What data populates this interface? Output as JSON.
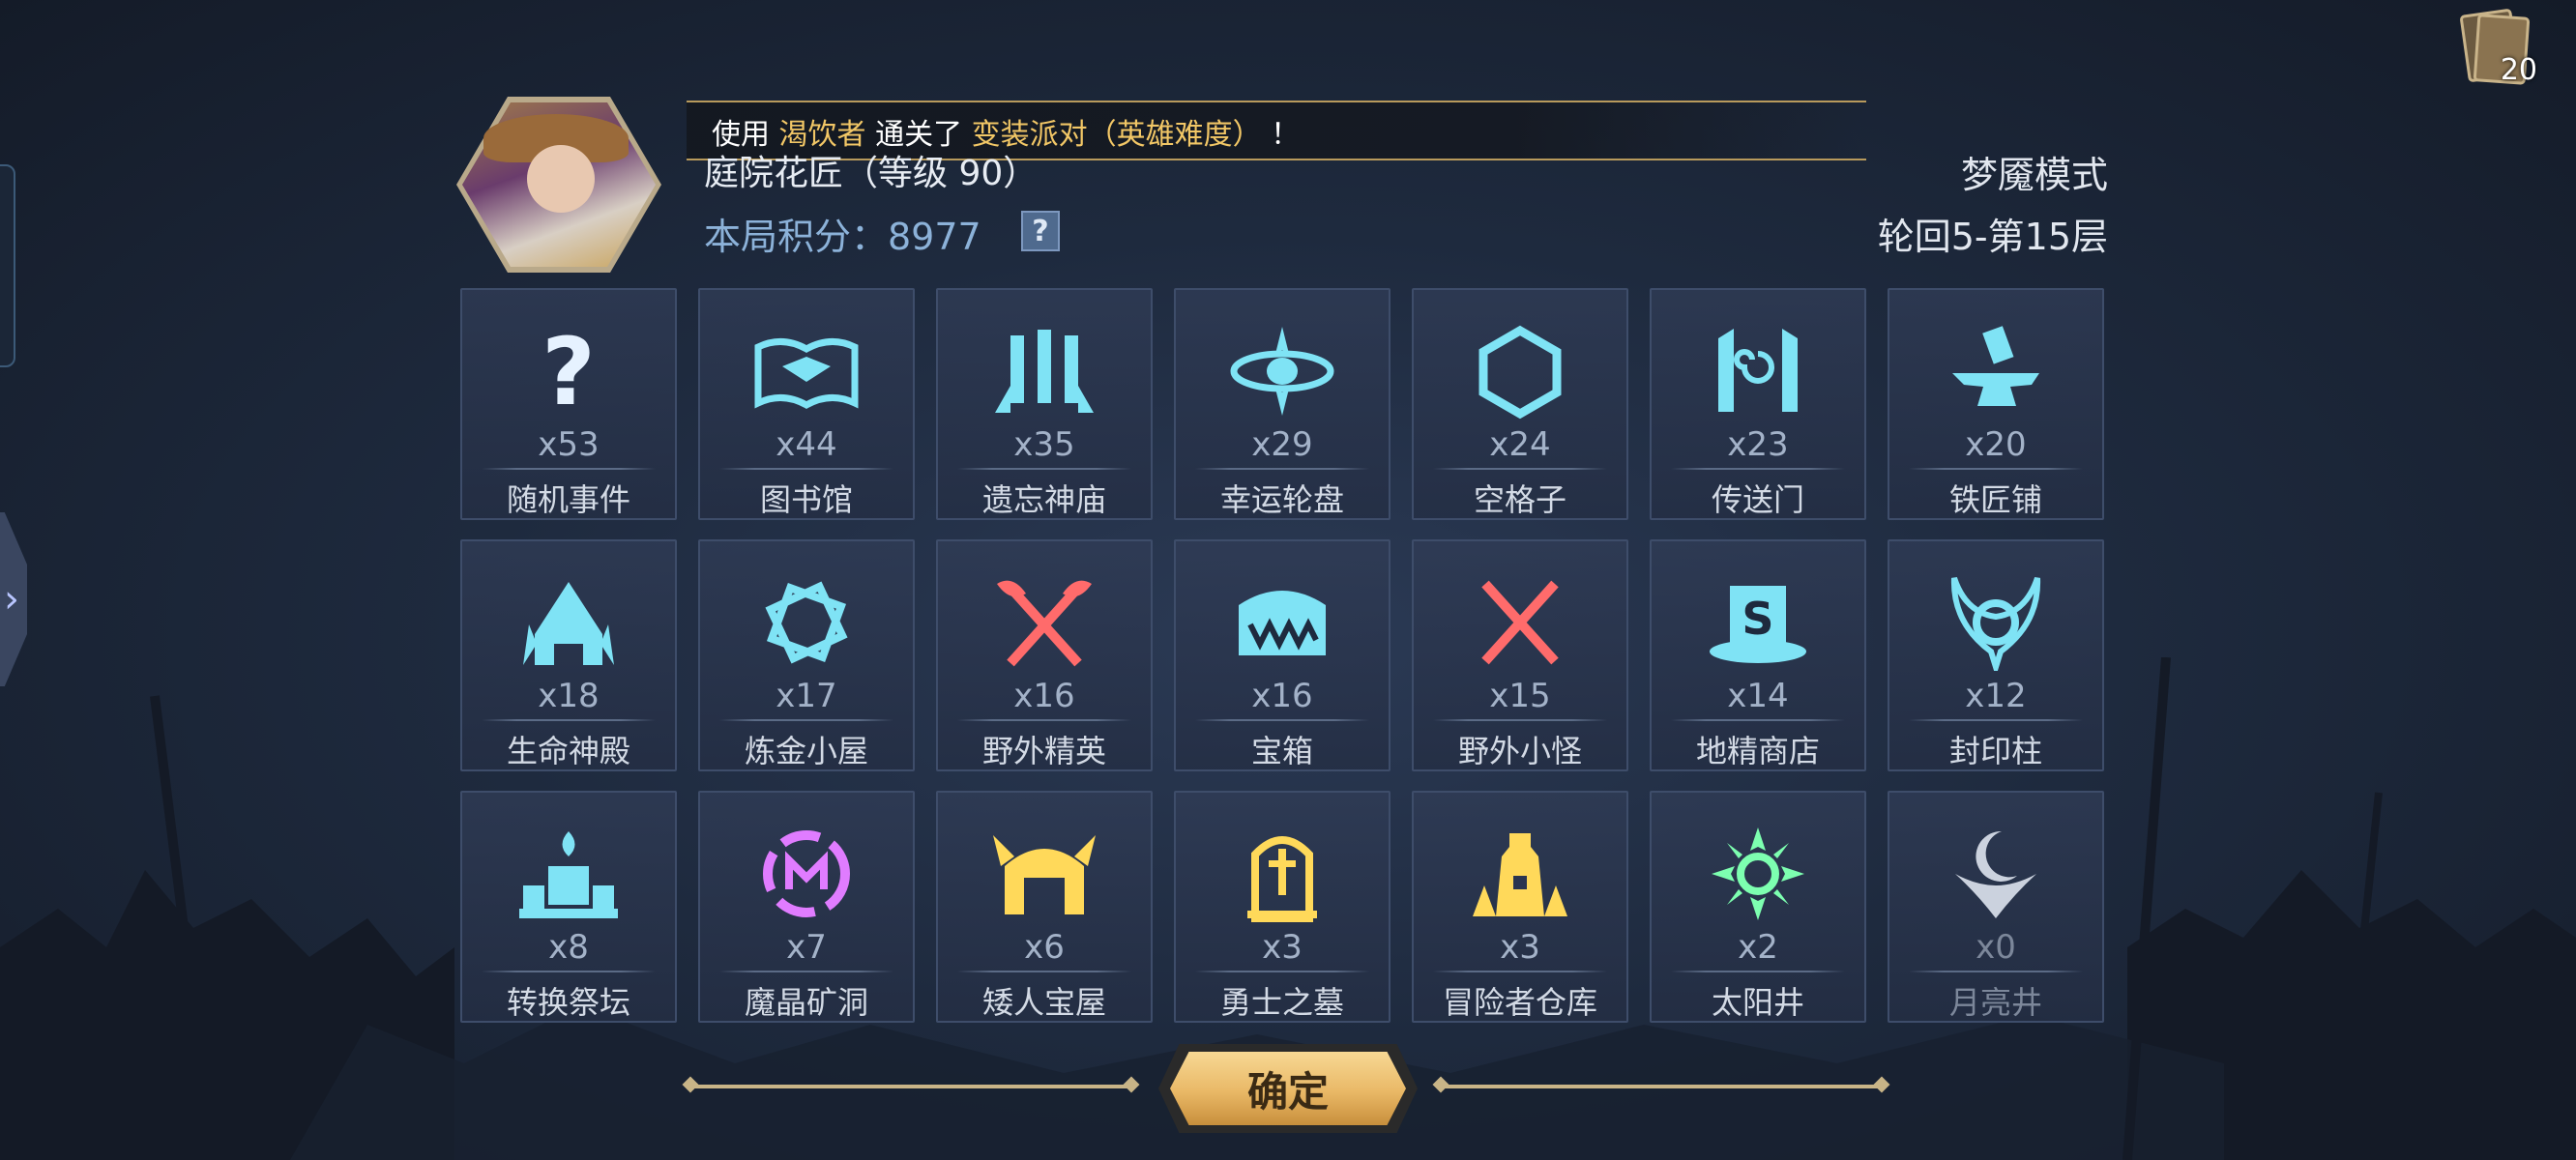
{
  "header": {
    "notice_prefix": "使用 ",
    "notice_hero": "渴饮者",
    "notice_mid": " 通关了 ",
    "notice_event": "变装派对（英雄难度）",
    "notice_suffix": " ！",
    "player_name": "庭院花匠（等级 90）",
    "score_label": "本局积分：8977",
    "help_label": "?",
    "mode": "梦魇模式",
    "floor": "轮回5-第15层"
  },
  "deck": {
    "count": "20"
  },
  "nodes": [
    {
      "count": "x53",
      "label": "随机事件",
      "icon": "question-icon",
      "color": "#d8ecff"
    },
    {
      "count": "x44",
      "label": "图书馆",
      "icon": "book-icon",
      "color": "#7fe3f5"
    },
    {
      "count": "x35",
      "label": "遗忘神庙",
      "icon": "temple-icon",
      "color": "#7fe3f5"
    },
    {
      "count": "x29",
      "label": "幸运轮盘",
      "icon": "wheel-icon",
      "color": "#7fe3f5"
    },
    {
      "count": "x24",
      "label": "空格子",
      "icon": "hexagon-icon",
      "color": "#7fe3f5"
    },
    {
      "count": "x23",
      "label": "传送门",
      "icon": "portal-icon",
      "color": "#7fe3f5"
    },
    {
      "count": "x20",
      "label": "铁匠铺",
      "icon": "anvil-icon",
      "color": "#7fe3f5"
    },
    {
      "count": "x18",
      "label": "生命神殿",
      "icon": "life-shrine-icon",
      "color": "#7fe3f5"
    },
    {
      "count": "x17",
      "label": "炼金小屋",
      "icon": "alchemy-icon",
      "color": "#7fe3f5"
    },
    {
      "count": "x16",
      "label": "野外精英",
      "icon": "crossed-axes-icon",
      "color": "#ff6b6b"
    },
    {
      "count": "x16",
      "label": "宝箱",
      "icon": "chest-icon",
      "color": "#7fe3f5"
    },
    {
      "count": "x15",
      "label": "野外小怪",
      "icon": "crossed-swords-icon",
      "color": "#ff6b6b"
    },
    {
      "count": "x14",
      "label": "地精商店",
      "icon": "shop-hat-icon",
      "color": "#7fe3f5"
    },
    {
      "count": "x12",
      "label": "封印柱",
      "icon": "seal-icon",
      "color": "#7fe3f5"
    },
    {
      "count": "x8",
      "label": "转换祭坛",
      "icon": "altar-icon",
      "color": "#7fe3f5"
    },
    {
      "count": "x7",
      "label": "魔晶矿洞",
      "icon": "crystal-mine-icon",
      "color": "#e07cff"
    },
    {
      "count": "x6",
      "label": "矮人宝屋",
      "icon": "dwarf-helmet-icon",
      "color": "#ffd95a"
    },
    {
      "count": "x3",
      "label": "勇士之墓",
      "icon": "tomb-icon",
      "color": "#ffd95a"
    },
    {
      "count": "x3",
      "label": "冒险者仓库",
      "icon": "warehouse-icon",
      "color": "#ffd95a"
    },
    {
      "count": "x2",
      "label": "太阳井",
      "icon": "sun-well-icon",
      "color": "#7dffb0"
    },
    {
      "count": "x0",
      "label": "月亮井",
      "icon": "moon-well-icon",
      "color": "#e8eef8"
    }
  ],
  "confirm_label": "确定"
}
